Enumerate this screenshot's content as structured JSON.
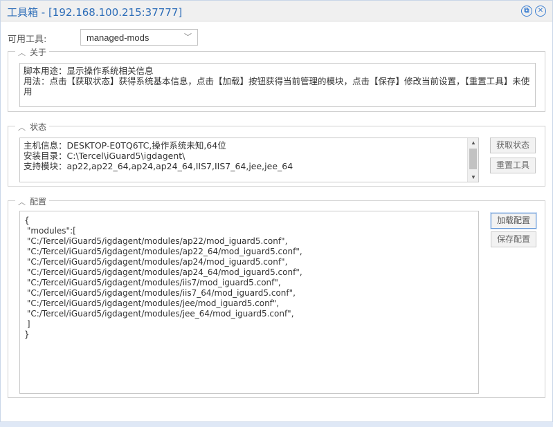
{
  "window": {
    "title": "工具箱 - [192.168.100.215:37777]",
    "restore_icon": "restore-icon",
    "close_icon": "close-icon"
  },
  "tool": {
    "label": "可用工具:",
    "selected": "managed-mods"
  },
  "about": {
    "legend": "关于",
    "text": "脚本用途：显示操作系统相关信息\n用法：点击【获取状态】获得系统基本信息，点击【加载】按钮获得当前管理的模块，点击【保存】修改当前设置，【重置工具】未使用"
  },
  "status": {
    "legend": "状态",
    "lines": [
      "主机信息：DESKTOP-E0TQ6TC,操作系统未知,64位",
      "安装目录：C:\\Tercel\\iGuard5\\igdagent\\",
      "支持模块：ap22,ap22_64,ap24,ap24_64,IIS7,IIS7_64,jee,jee_64"
    ],
    "get_button": "获取状态",
    "reset_button": "重置工具"
  },
  "config": {
    "legend": "配置",
    "text": "{\n \"modules\":[\n \"C:/Tercel/iGuard5/igdagent/modules/ap22/mod_iguard5.conf\",\n \"C:/Tercel/iGuard5/igdagent/modules/ap22_64/mod_iguard5.conf\",\n \"C:/Tercel/iGuard5/igdagent/modules/ap24/mod_iguard5.conf\",\n \"C:/Tercel/iGuard5/igdagent/modules/ap24_64/mod_iguard5.conf\",\n \"C:/Tercel/iGuard5/igdagent/modules/iis7/mod_iguard5.conf\",\n \"C:/Tercel/iGuard5/igdagent/modules/iis7_64/mod_iguard5.conf\",\n \"C:/Tercel/iGuard5/igdagent/modules/jee/mod_iguard5.conf\",\n \"C:/Tercel/iGuard5/igdagent/modules/jee_64/mod_iguard5.conf\",\n ]\n}",
    "load_button": "加载配置",
    "save_button": "保存配置"
  }
}
